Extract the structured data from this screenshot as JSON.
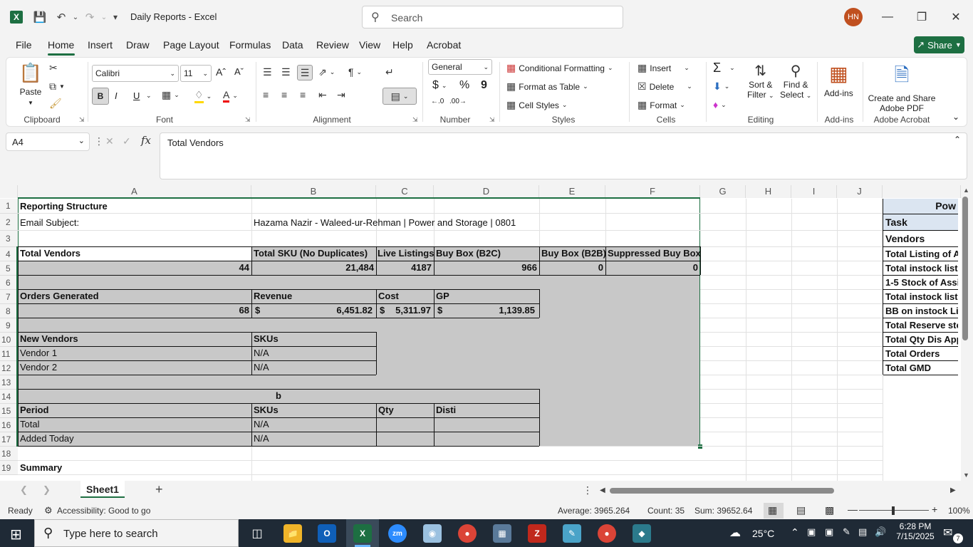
{
  "titlebar": {
    "excel_logo": "X",
    "doc_title": "Daily Reports  -  Excel",
    "search_placeholder": "Search",
    "avatar_initials": "HN",
    "icons": [
      "save-icon",
      "undo-icon",
      "redo-icon",
      "customize-qat-icon",
      "minimize-icon",
      "restore-icon",
      "close-icon"
    ]
  },
  "menu": {
    "tabs": [
      "File",
      "Home",
      "Insert",
      "Draw",
      "Page Layout",
      "Formulas",
      "Data",
      "Review",
      "View",
      "Help",
      "Acrobat"
    ],
    "active": "Home",
    "share_label": "Share"
  },
  "ribbon": {
    "clipboard": {
      "paste": "Paste",
      "label": "Clipboard"
    },
    "font": {
      "name": "Calibri",
      "size": "11",
      "bold": "B",
      "italic": "I",
      "underline": "U",
      "label": "Font"
    },
    "alignment": {
      "label": "Alignment"
    },
    "number": {
      "format": "General",
      "currency": "$",
      "percent": "%",
      "comma": "9",
      "label": "Number"
    },
    "styles": {
      "conditional": "Conditional Formatting",
      "format_table": "Format as Table",
      "cell_styles": "Cell Styles",
      "label": "Styles"
    },
    "cells": {
      "insert": "Insert",
      "delete": "Delete",
      "format": "Format",
      "label": "Cells"
    },
    "editing": {
      "sort_line1": "Sort &",
      "sort_line2": "Filter",
      "find_line1": "Find &",
      "find_line2": "Select",
      "label": "Editing"
    },
    "addins": {
      "btn": "Add-ins",
      "label": "Add-ins"
    },
    "acrobat": {
      "line1": "Create and Share",
      "line2": "Adobe PDF",
      "label": "Adobe Acrobat"
    }
  },
  "formula_bar": {
    "name_box": "A4",
    "fx": "fx",
    "content": "Total Vendors"
  },
  "columns": [
    "A",
    "B",
    "C",
    "D",
    "E",
    "F",
    "G",
    "H",
    "I",
    "J"
  ],
  "rows": [
    "1",
    "2",
    "3",
    "4",
    "5",
    "6",
    "7",
    "8",
    "9",
    "10",
    "11",
    "12",
    "13",
    "14",
    "15",
    "16",
    "17",
    "18",
    "19"
  ],
  "cells": {
    "a1": "Reporting Structure",
    "a2": "Email Subject:",
    "b2": "Hazama Nazir - Waleed-ur-Rehman | Power and Storage | 0801",
    "a4": "Total Vendors",
    "b4": "Total SKU (No Duplicates)",
    "c4": "Live Listings",
    "d4": "Buy Box (B2C)",
    "e4": "Buy Box (B2B)",
    "f4": "Suppressed Buy Box",
    "a5": "44",
    "b5": "21,484",
    "c5": "4187",
    "d5": "966",
    "e5": "0",
    "f5": "0",
    "a7": "Orders Generated",
    "b7": "Revenue",
    "c7": "Cost",
    "d7": "GP",
    "a8": "68",
    "b8_sym": "$",
    "b8": "6,451.82",
    "c8_sym": "$",
    "c8": "5,311.97",
    "d8_sym": "$",
    "d8": "1,139.85",
    "a10": "New Vendors",
    "b10": "SKUs",
    "a11": "Vendor 1",
    "b11": "N/A",
    "a12": "Vendor 2",
    "b12": "N/A",
    "a14": "b",
    "a15": "Period",
    "b15": "SKUs",
    "c15": "Qty",
    "d15": "Disti",
    "a16": "Total",
    "b16": "N/A",
    "a17": "Added Today",
    "b17": "N/A",
    "a19": "Summary"
  },
  "side_table": {
    "header": "Pow",
    "rows": [
      "Task",
      "Vendors",
      "Total Listing of A",
      "Total instock listi",
      "1-5 Stock of Assig",
      "Total instock listi",
      "BB on instock Lis",
      "Total Reserve sto",
      "Total Qty Dis App",
      "Total Orders",
      "Total GMD"
    ]
  },
  "sheets": {
    "active": "Sheet1",
    "add": "+"
  },
  "status": {
    "ready": "Ready",
    "accessibility": "Accessibility: Good to go",
    "average": "Average: 3965.264",
    "count": "Count: 35",
    "sum": "Sum: 39652.64",
    "zoom": "100%"
  },
  "taskbar": {
    "search_placeholder": "Type here to search",
    "weather": "25°C",
    "time": "6:28 PM",
    "date": "7/15/2025",
    "notif_count": "7"
  },
  "colors": {
    "accent": "#1d6f42",
    "selection_fill": "#c8c8c8",
    "taskbar": "#1f2a36"
  }
}
